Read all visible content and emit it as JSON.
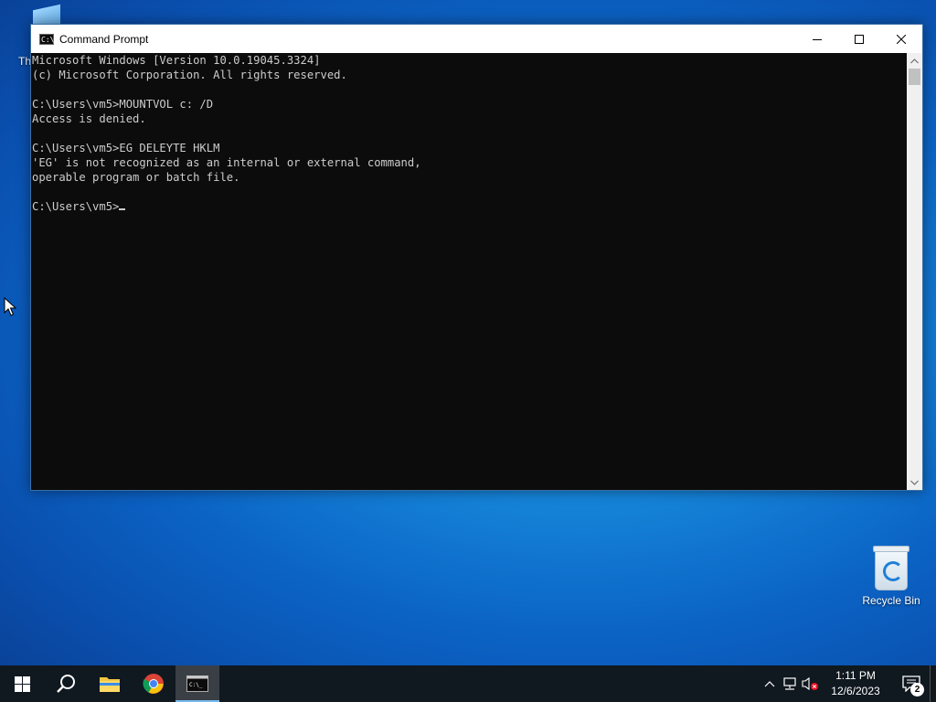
{
  "desktop": {
    "icons": [
      {
        "label": "Th",
        "icon": "this-pc-icon"
      },
      {
        "label": "Recycle Bin",
        "icon": "recycle-bin-icon"
      }
    ]
  },
  "window": {
    "title": "Command Prompt",
    "icon": "cmd-icon",
    "buttons": {
      "minimize": "minimize-icon",
      "maximize": "maximize-icon",
      "close": "close-icon"
    },
    "console_lines": [
      "Microsoft Windows [Version 10.0.19045.3324]",
      "(c) Microsoft Corporation. All rights reserved.",
      "",
      "C:\\Users\\vm5>MOUNTVOL c: /D",
      "Access is denied.",
      "",
      "C:\\Users\\vm5>EG DELEYTE HKLM",
      "'EG' is not recognized as an internal or external command,",
      "operable program or batch file.",
      ""
    ],
    "prompt": "C:\\Users\\vm5>",
    "colors": {
      "background": "#0c0c0c",
      "text": "#cccccc"
    }
  },
  "taskbar": {
    "items": [
      {
        "name": "start",
        "icon": "windows-start-icon"
      },
      {
        "name": "search",
        "icon": "search-icon"
      },
      {
        "name": "file-explorer",
        "icon": "folder-icon"
      },
      {
        "name": "chrome",
        "icon": "chrome-icon"
      },
      {
        "name": "command-prompt",
        "icon": "cmd-icon",
        "active": true
      }
    ],
    "tray": {
      "icons": [
        "chevron-up-icon",
        "network-icon",
        "volume-muted-icon"
      ],
      "time": "1:11 PM",
      "date": "12/6/2023",
      "notifications_count": "2"
    }
  }
}
